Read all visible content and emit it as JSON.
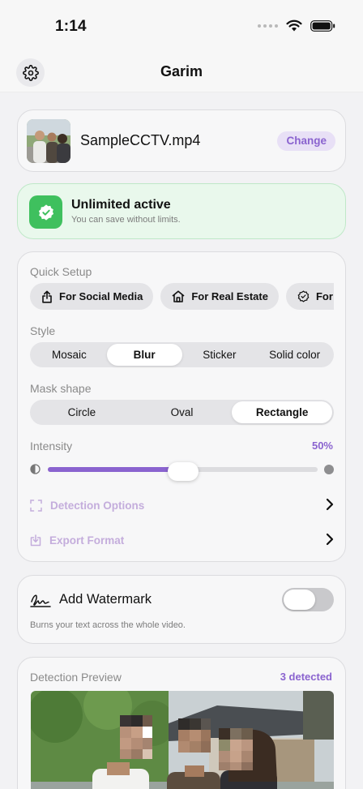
{
  "status_bar": {
    "time": "1:14"
  },
  "nav": {
    "title": "Garim",
    "settings_icon": "gear-icon"
  },
  "file": {
    "name": "SampleCCTV.mp4",
    "change_label": "Change"
  },
  "plan": {
    "title": "Unlimited active",
    "subtitle": "You can save without limits."
  },
  "quick_setup": {
    "label": "Quick Setup",
    "presets": [
      {
        "label": "For Social Media",
        "icon": "share-icon"
      },
      {
        "label": "For Real Estate",
        "icon": "house-icon"
      },
      {
        "label": "For Le",
        "icon": "badge-check-icon"
      }
    ]
  },
  "style": {
    "label": "Style",
    "options": [
      "Mosaic",
      "Blur",
      "Sticker",
      "Solid color"
    ],
    "selected": "Blur"
  },
  "mask_shape": {
    "label": "Mask shape",
    "options": [
      "Circle",
      "Oval",
      "Rectangle"
    ],
    "selected": "Rectangle"
  },
  "intensity": {
    "label": "Intensity",
    "value_text": "50%",
    "value": 0.5
  },
  "links": {
    "detection_options": "Detection Options",
    "export_format": "Export Format"
  },
  "watermark": {
    "title": "Add Watermark",
    "subtitle": "Burns your text across the whole video.",
    "enabled": false
  },
  "preview": {
    "label": "Detection Preview",
    "count_text": "3 detected"
  },
  "colors": {
    "accent": "#8a63cf",
    "success": "#3fc05e",
    "chip_bg": "#e4e4e7"
  }
}
